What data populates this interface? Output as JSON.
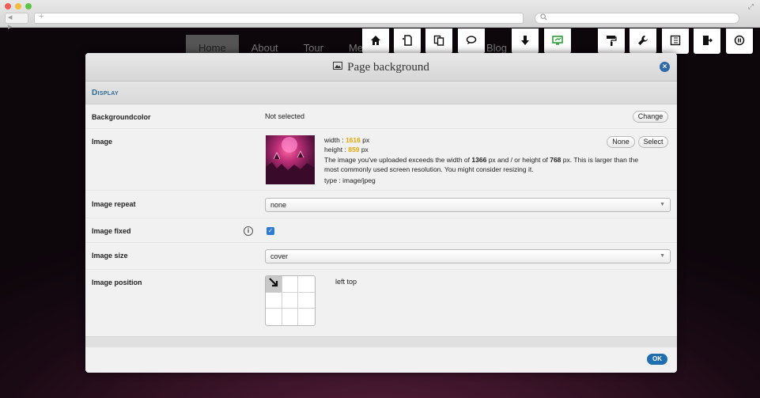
{
  "browser": {
    "new_tab_symbol": "+",
    "nav_arrows": "◀ ▶",
    "resize_symbol": "⤢",
    "search_icon": "search-icon"
  },
  "site_nav": [
    "Home",
    "About",
    "Tour",
    "Med",
    "Blog"
  ],
  "toolbar_icons": [
    "home-icon",
    "page-add-icon",
    "pages-copy-icon",
    "chat-icon",
    "download-icon",
    "monitor-icon",
    "paint-roller-icon",
    "wrench-icon",
    "layout-icon",
    "exit-icon",
    "power-icon"
  ],
  "dialog": {
    "title": "Page background",
    "close_symbol": "×",
    "section": "Display",
    "rows": {
      "bgcolor": {
        "label": "Backgroundcolor",
        "value": "Not selected",
        "button": "Change"
      },
      "image": {
        "label": "Image",
        "width_label": "width :",
        "width": "1616",
        "width_unit": "px",
        "height_label": "height :",
        "height": "859",
        "height_unit": "px",
        "warning_pre": "The image you've uploaded exceeds the width of",
        "max_w": "1366",
        "warning_mid": "px and / or height of",
        "max_h": "768",
        "warning_post": "px. This is larger than the",
        "warning_line2": "most commonly used screen resolution. You might consider resizing it.",
        "type": "type : image/jpeg",
        "none_button": "None",
        "select_button": "Select"
      },
      "repeat": {
        "label": "Image repeat",
        "value": "none"
      },
      "fixed": {
        "label": "Image fixed",
        "checked": true
      },
      "size": {
        "label": "Image size",
        "value": "cover"
      },
      "position": {
        "label": "Image position",
        "value": "left top"
      }
    },
    "ok_button": "OK"
  },
  "colors": {
    "accent": "#1f6eb0",
    "highlight": "#e8a800",
    "section_text": "#2a6a9a"
  }
}
